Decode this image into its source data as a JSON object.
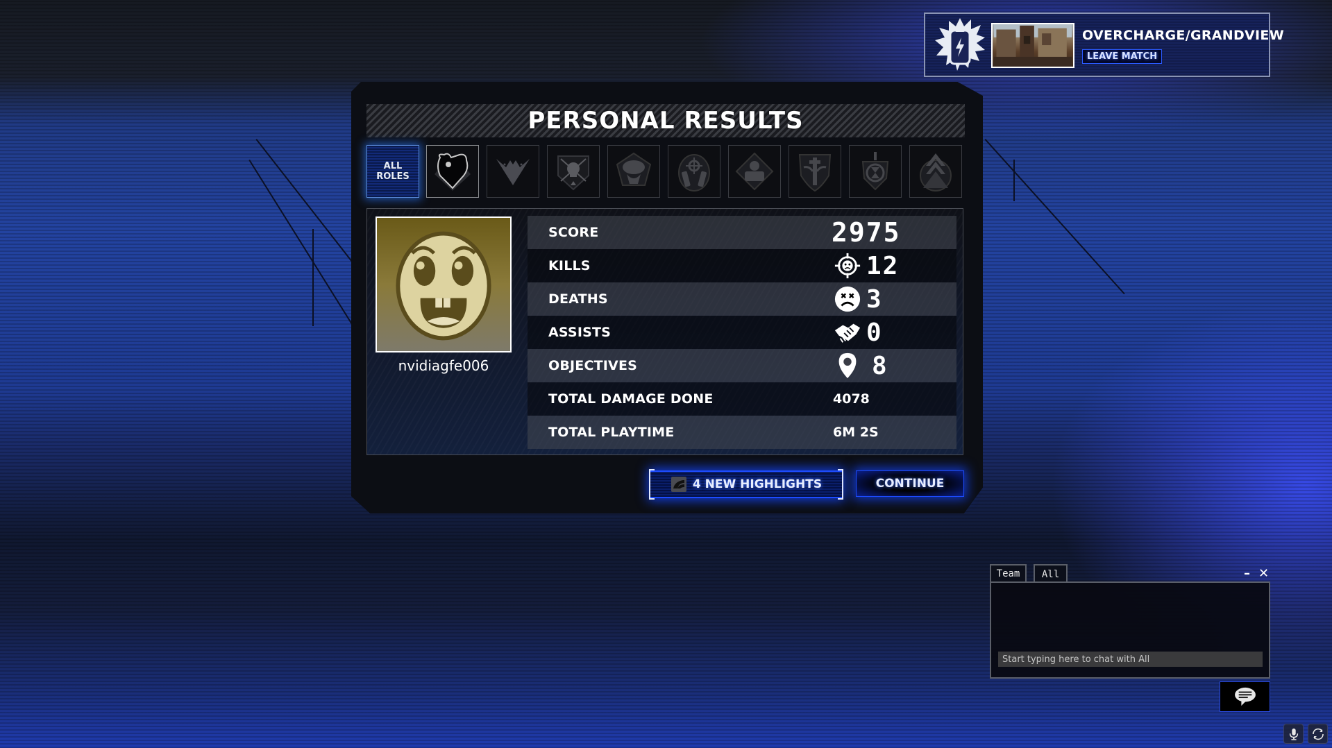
{
  "match": {
    "mode_map": "OVERCHARGE/GRANDVIEW",
    "leave_label": "LEAVE MATCH",
    "mode_icon": "overcharge-battery-icon"
  },
  "panel": {
    "title": "PERSONAL RESULTS",
    "role_tabs": [
      {
        "label": "ALL\nROLES",
        "icon": "all-roles",
        "active": true
      },
      {
        "icon": "brawler-fist-icon"
      },
      {
        "icon": "eagle-wings-icon"
      },
      {
        "icon": "skull-arrows-icon"
      },
      {
        "icon": "cobra-icon"
      },
      {
        "icon": "crosshair-pistols-icon"
      },
      {
        "icon": "heavy-soldier-icon"
      },
      {
        "icon": "medic-caduceus-icon"
      },
      {
        "icon": "hourglass-shield-icon"
      },
      {
        "icon": "chevron-rank-icon"
      }
    ],
    "player": {
      "username": "nvidiagfe006",
      "avatar": "happy-face-avatar"
    },
    "stats": [
      {
        "label": "SCORE",
        "value": "2975",
        "icon": null
      },
      {
        "label": "KILLS",
        "value": "12",
        "icon": "crosshair-skull-icon"
      },
      {
        "label": "DEATHS",
        "value": "3",
        "icon": "dead-face-icon"
      },
      {
        "label": "ASSISTS",
        "value": "0",
        "icon": "handshake-icon"
      },
      {
        "label": "OBJECTIVES",
        "value": "8",
        "icon": "map-pin-icon"
      },
      {
        "label": "TOTAL DAMAGE DONE",
        "value": "4078",
        "icon": null
      },
      {
        "label": "TOTAL PLAYTIME",
        "value": "6M 2S",
        "icon": null
      }
    ],
    "highlights_label": "4 NEW HIGHLIGHTS",
    "continue_label": "CONTINUE"
  },
  "chat": {
    "tabs": [
      "Team",
      "All"
    ],
    "active_tab": "All",
    "input_placeholder": "Start typing here to chat with All",
    "input_value": "",
    "minimize": "–",
    "close": "✕"
  },
  "colors": {
    "accent_blue": "#1d4cff",
    "panel_bg": "#0c0e14",
    "text": "#ffffff"
  }
}
